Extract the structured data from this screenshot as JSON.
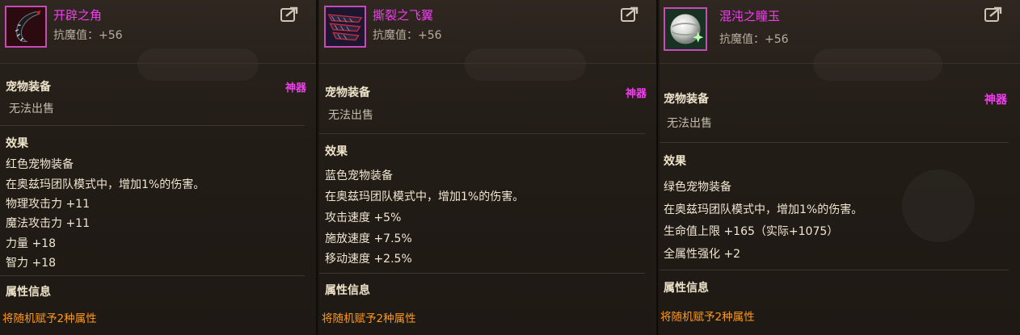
{
  "cards": [
    {
      "name": "开辟之角",
      "anti_magic": "抗魔值：+56",
      "category": "宠物装备",
      "tier": "神器",
      "sale": "无法出售",
      "effect_header": "效果",
      "effects": [
        "红色宠物装备",
        "在奥兹玛团队模式中，增加1%的伤害。",
        "物理攻击力 +11",
        "魔法攻击力 +11",
        "力量 +18",
        "智力 +18"
      ],
      "attr_header": "属性信息",
      "attr_note": "将随机赋予2种属性"
    },
    {
      "name": "撕裂之飞翼",
      "anti_magic": "抗魔值：+56",
      "category": "宠物装备",
      "tier": "神器",
      "sale": "无法出售",
      "effect_header": "效果",
      "effects": [
        "蓝色宠物装备",
        "在奥兹玛团队模式中，增加1%的伤害。",
        "攻击速度 +5%",
        "施放速度 +7.5%",
        "移动速度 +2.5%"
      ],
      "attr_header": "属性信息",
      "attr_note": "将随机赋予2种属性"
    },
    {
      "name": "混沌之瞳玉",
      "anti_magic": "抗魔值：+56",
      "category": "宠物装备",
      "tier": "神器",
      "sale": "无法出售",
      "effect_header": "效果",
      "effects": [
        "绿色宠物装备",
        "在奥兹玛团队模式中，增加1%的伤害。",
        "生命值上限 +165（实际+1075）",
        "全属性强化 +2"
      ],
      "attr_header": "属性信息",
      "attr_note": "将随机赋予2种属性"
    }
  ],
  "colors": {
    "item_name": "#f23df0",
    "tier": "#f23df0",
    "attr_note": "#ff9a1d",
    "text": "#f0e6d2"
  },
  "icons": [
    "horn-icon",
    "wing-icon",
    "orb-icon",
    "share-icon"
  ]
}
